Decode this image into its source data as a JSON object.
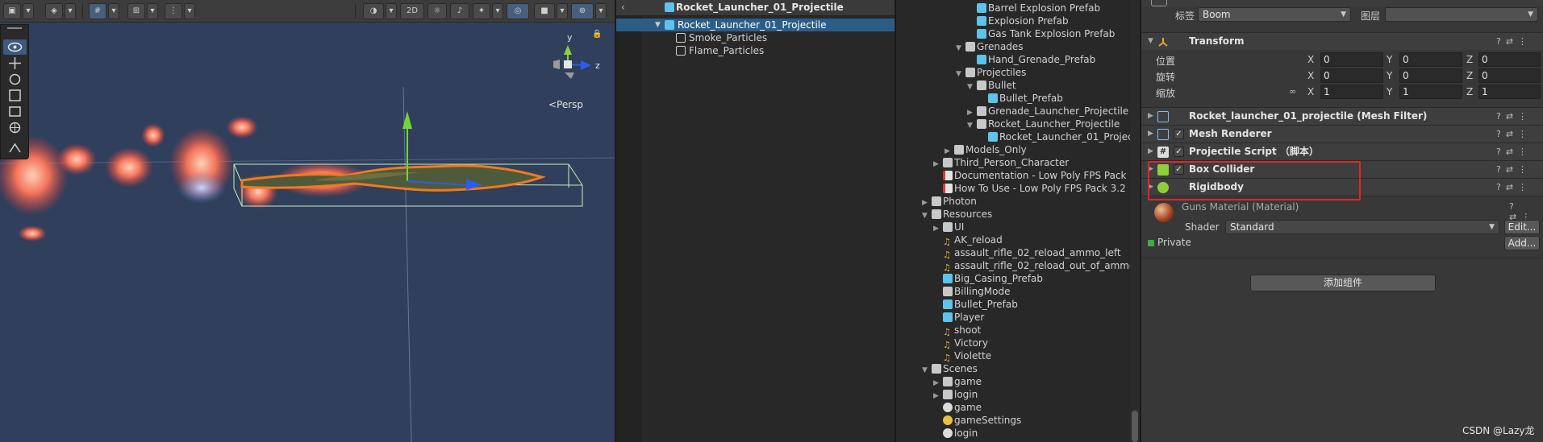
{
  "scene": {
    "toolbar": {
      "view_mode_2d": "2D"
    },
    "persp_label": "<Persp",
    "axis_labels": {
      "y": "y",
      "z": "z"
    }
  },
  "hierarchy": {
    "header_title": "Rocket_Launcher_01_Projectile",
    "back_glyph": "‹",
    "items": [
      {
        "label": "Rocket_Launcher_01_Projectile",
        "selected": true
      },
      {
        "label": "Smoke_Particles",
        "selected": false
      },
      {
        "label": "Flame_Particles",
        "selected": false
      }
    ]
  },
  "project": {
    "items": [
      {
        "label": "Barrel Explosion Prefab",
        "type": "prefab"
      },
      {
        "label": "Explosion Prefab",
        "type": "prefab"
      },
      {
        "label": "Gas Tank Explosion Prefab",
        "type": "prefab"
      },
      {
        "label": "Grenades",
        "type": "folder"
      },
      {
        "label": "Hand_Grenade_Prefab",
        "type": "prefab"
      },
      {
        "label": "Projectiles",
        "type": "folder"
      },
      {
        "label": "Bullet",
        "type": "folder"
      },
      {
        "label": "Bullet_Prefab",
        "type": "prefab"
      },
      {
        "label": "Grenade_Launcher_Projectile",
        "type": "folder"
      },
      {
        "label": "Rocket_Launcher_Projectile",
        "type": "folder"
      },
      {
        "label": "Rocket_Launcher_01_Projec",
        "type": "prefab"
      },
      {
        "label": "Models_Only",
        "type": "folder"
      },
      {
        "label": "Third_Person_Character",
        "type": "folder"
      },
      {
        "label": "Documentation - Low Poly FPS Pack",
        "type": "doc"
      },
      {
        "label": "How To Use - Low Poly FPS Pack 3.2",
        "type": "doc"
      },
      {
        "label": "Photon",
        "type": "folder"
      },
      {
        "label": "Resources",
        "type": "folder"
      },
      {
        "label": "UI",
        "type": "folder"
      },
      {
        "label": "AK_reload",
        "type": "audio"
      },
      {
        "label": "assault_rifle_02_reload_ammo_left",
        "type": "audio"
      },
      {
        "label": "assault_rifle_02_reload_out_of_ammo",
        "type": "audio"
      },
      {
        "label": "Big_Casing_Prefab",
        "type": "prefab"
      },
      {
        "label": "BillingMode",
        "type": "doc"
      },
      {
        "label": "Bullet_Prefab",
        "type": "prefab"
      },
      {
        "label": "Player",
        "type": "prefab"
      },
      {
        "label": "shoot",
        "type": "audio"
      },
      {
        "label": "Victory",
        "type": "audio"
      },
      {
        "label": "Violette",
        "type": "audio"
      },
      {
        "label": "Scenes",
        "type": "folder"
      },
      {
        "label": "game",
        "type": "folder"
      },
      {
        "label": "login",
        "type": "folder"
      },
      {
        "label": "game",
        "type": "scene"
      },
      {
        "label": "gameSettings",
        "type": "setting"
      },
      {
        "label": "login",
        "type": "scene"
      }
    ]
  },
  "inspector": {
    "tag_label": "标签",
    "tag_value": "Boom",
    "layer_label": "图层",
    "layer_value": "",
    "transform": {
      "title": "Transform",
      "position_label": "位置",
      "rotation_label": "旋转",
      "scale_label": "缩放",
      "axis_x": "X",
      "axis_y": "Y",
      "axis_z": "Z",
      "position": [
        "0",
        "0",
        "0"
      ],
      "rotation": [
        "0",
        "0",
        "0"
      ],
      "scale": [
        "1",
        "1",
        "1"
      ]
    },
    "components": [
      {
        "title": "Rocket_launcher_01_projectile (Mesh Filter)",
        "checkbox": false
      },
      {
        "title": "Mesh Renderer",
        "checkbox": true
      },
      {
        "title": "Projectile Script （脚本）",
        "checkbox": true
      },
      {
        "title": "Box Collider",
        "checkbox": true
      },
      {
        "title": "Rigidbody",
        "checkbox": false
      }
    ],
    "material": {
      "name": "Guns Material (Material)",
      "shader_label": "Shader",
      "shader_value": "Standard",
      "edit_button": "Edit...",
      "private_label": "Private",
      "add_button": "Add..."
    },
    "add_component_button": "添加组件"
  },
  "watermark": "CSDN @Lazy龙",
  "colors": {
    "selection": "#2c5d87",
    "highlight": "#e0262b",
    "scene_bg": "#2f3f5c",
    "projectile_outline": "#f07a1e"
  }
}
